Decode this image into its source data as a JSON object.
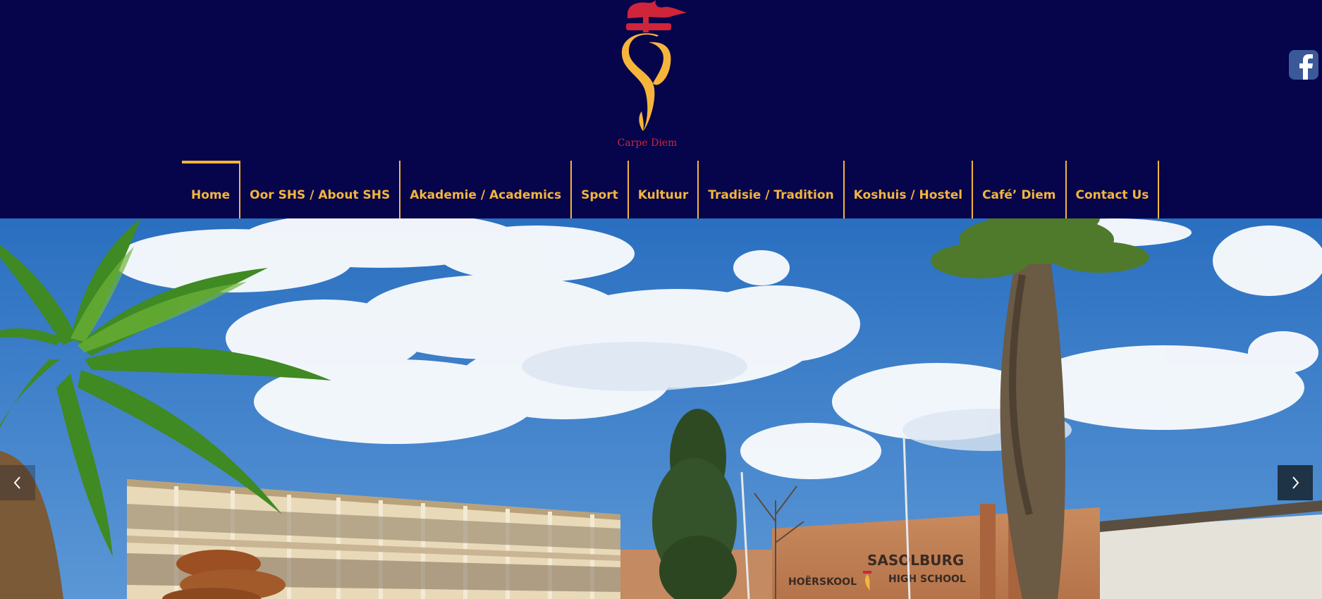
{
  "brand": {
    "motto": "Carpe Diem",
    "logo_colors": {
      "flame": "#d0243a",
      "letter": "#f5b53b"
    }
  },
  "social": {
    "icon": "facebook-icon",
    "color": "#3b5998"
  },
  "nav": {
    "items": [
      {
        "label": "Home",
        "active": true
      },
      {
        "label": "Oor SHS / About SHS"
      },
      {
        "label": "Akademie / Academics"
      },
      {
        "label": "Sport"
      },
      {
        "label": "Kultuur"
      },
      {
        "label": "Tradisie / Tradition"
      },
      {
        "label": "Koshuis / Hostel"
      },
      {
        "label": "Café’ Diem"
      },
      {
        "label": "Contact Us"
      }
    ],
    "accent_color": "#f5b53b"
  },
  "hero": {
    "building_sign": {
      "line1": "SASOLBURG",
      "line2_left": "HOËRSKOOL",
      "line2_right": "HIGH SCHOOL"
    }
  },
  "slider": {
    "prev_icon": "chevron-left-icon",
    "next_icon": "chevron-right-icon"
  },
  "theme": {
    "background": "#06044a",
    "accent": "#f5b53b"
  }
}
